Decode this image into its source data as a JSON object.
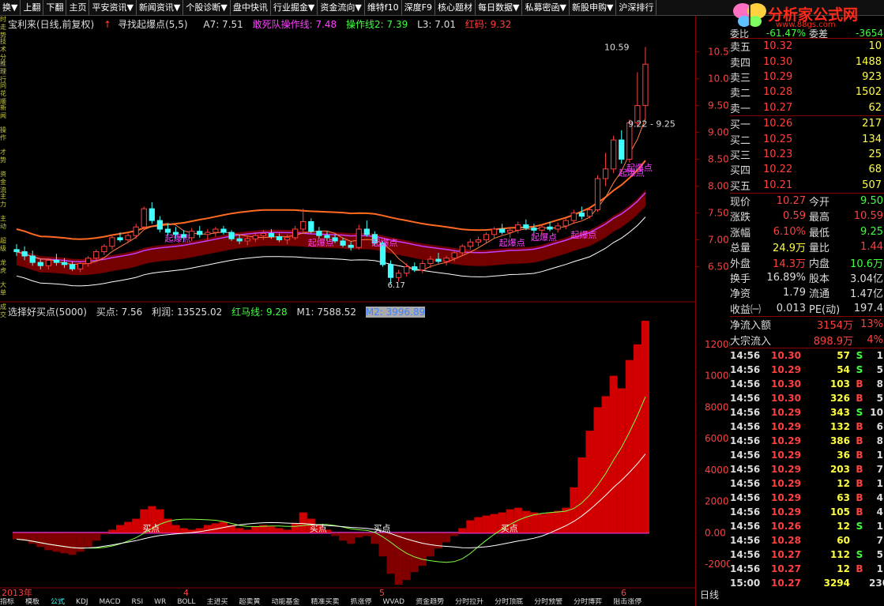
{
  "menu": [
    "换▼",
    "上翻",
    "下翻",
    "主页",
    "平安资讯▼",
    "新闻资讯▼",
    "个股诊断▼",
    "盘中快讯",
    "行业掘金▼",
    "资金流向▼",
    "维特f10",
    "深度F9",
    "核心题材",
    "每日数据▼",
    "私募密函▼",
    "新股申购▼",
    "沪深排行"
  ],
  "logo": {
    "text": "分析家公式网",
    "url": "www.88gs.com"
  },
  "left_sidebar": [
    "时走势",
    "技术分析",
    "推理行",
    "同花顺",
    "新闻",
    "操作",
    "才势",
    "资金流",
    "主力",
    "主动",
    "超级",
    "龙虎",
    "大单",
    "成交"
  ],
  "main_header": {
    "stock": "宝利来(日线,前复权)",
    "ind": "寻找起爆点(5,5)",
    "a7": "A7: 7.51",
    "dead": "敢死队操作线: 7.48",
    "op2": "操作线2: 7.39",
    "l3": "L3: 7.01",
    "red": "红码: 9.32"
  },
  "sub_header": {
    "name": "选择好买点(5000)",
    "buy": "买点: 7.56",
    "profit": "利润: 13525.02",
    "hongma": "红马线: 9.28",
    "m1": "M1: 7588.52",
    "m2": "M2: 3996.89"
  },
  "price_axis": [
    "10.50",
    "10.00",
    "9.50",
    "9.00",
    "8.50",
    "8.00",
    "7.50",
    "7.00",
    "6.50"
  ],
  "ind_axis": [
    "12000",
    "10000",
    "8000",
    "6000",
    "4000",
    "2000",
    "0.00",
    "-2000"
  ],
  "annotations": {
    "high": "10.59",
    "range": "9.22 - 9.25",
    "low": "6.17",
    "qi": "起爆点",
    "buy": "买点"
  },
  "x_labels": [
    "2013年",
    "4",
    "5",
    "6"
  ],
  "day_label": "日线",
  "order_book": {
    "top_cut": {
      "l": "委比",
      "v": "-61.47%",
      "l2": "委差",
      "v2": "-3654"
    },
    "sells": [
      {
        "label": "卖五",
        "price": "10.32",
        "vol": "10"
      },
      {
        "label": "卖四",
        "price": "10.30",
        "vol": "1488"
      },
      {
        "label": "卖三",
        "price": "10.29",
        "vol": "923"
      },
      {
        "label": "卖二",
        "price": "10.28",
        "vol": "1502"
      },
      {
        "label": "卖一",
        "price": "10.27",
        "vol": "62"
      }
    ],
    "buys": [
      {
        "label": "买一",
        "price": "10.26",
        "vol": "217"
      },
      {
        "label": "买二",
        "price": "10.25",
        "vol": "134"
      },
      {
        "label": "买三",
        "price": "10.23",
        "vol": "25"
      },
      {
        "label": "买四",
        "price": "10.22",
        "vol": "68"
      },
      {
        "label": "买五",
        "price": "10.21",
        "vol": "507"
      }
    ]
  },
  "stats": [
    {
      "l1": "现价",
      "v1": "10.27",
      "c1": "#ff4040",
      "l2": "今开",
      "v2": "9.50",
      "c2": "#40ff40"
    },
    {
      "l1": "涨跌",
      "v1": "0.59",
      "c1": "#ff4040",
      "l2": "最高",
      "v2": "10.59",
      "c2": "#ff4040"
    },
    {
      "l1": "涨幅",
      "v1": "6.10%",
      "c1": "#ff4040",
      "l2": "最低",
      "v2": "9.25",
      "c2": "#40ff40"
    },
    {
      "l1": "总量",
      "v1": "24.9万",
      "c1": "#ffff40",
      "l2": "量比",
      "v2": "1.44",
      "c2": "#ff4040"
    },
    {
      "l1": "外盘",
      "v1": "14.3万",
      "c1": "#ff4040",
      "l2": "内盘",
      "v2": "10.6万",
      "c2": "#40ff40"
    },
    {
      "l1": "换手",
      "v1": "16.89%",
      "c1": "#ddd",
      "l2": "股本",
      "v2": "3.04亿",
      "c2": "#ddd"
    },
    {
      "l1": "净资",
      "v1": "1.79",
      "c1": "#ddd",
      "l2": "流通",
      "v2": "1.47亿",
      "c2": "#ddd"
    },
    {
      "l1": "收益㈠",
      "v1": "0.013",
      "c1": "#ddd",
      "l2": "PE(动)",
      "v2": "197.4",
      "c2": "#ddd"
    }
  ],
  "flows": [
    {
      "label": "净流入额",
      "value": "3154万",
      "pct": "13%"
    },
    {
      "label": "大宗流入",
      "value": "898.9万",
      "pct": "4%"
    }
  ],
  "ticks": [
    {
      "t": "14:56",
      "p": "10.30",
      "pc": "#ff4040",
      "v": "57",
      "s": "S",
      "sc": "#40ff40",
      "n": "1"
    },
    {
      "t": "14:56",
      "p": "10.29",
      "pc": "#ff4040",
      "v": "54",
      "s": "S",
      "sc": "#40ff40",
      "n": "5"
    },
    {
      "t": "14:56",
      "p": "10.30",
      "pc": "#ff4040",
      "v": "103",
      "s": "B",
      "sc": "#ff4040",
      "n": "8"
    },
    {
      "t": "14:56",
      "p": "10.30",
      "pc": "#ff4040",
      "v": "326",
      "s": "B",
      "sc": "#ff4040",
      "n": "5"
    },
    {
      "t": "14:56",
      "p": "10.29",
      "pc": "#ff4040",
      "v": "343",
      "s": "S",
      "sc": "#40ff40",
      "n": "10"
    },
    {
      "t": "14:56",
      "p": "10.29",
      "pc": "#ff4040",
      "v": "132",
      "s": "B",
      "sc": "#ff4040",
      "n": "6"
    },
    {
      "t": "14:56",
      "p": "10.29",
      "pc": "#ff4040",
      "v": "386",
      "s": "B",
      "sc": "#ff4040",
      "n": "8"
    },
    {
      "t": "14:56",
      "p": "10.29",
      "pc": "#ff4040",
      "v": "36",
      "s": "B",
      "sc": "#ff4040",
      "n": "1"
    },
    {
      "t": "14:56",
      "p": "10.29",
      "pc": "#ff4040",
      "v": "203",
      "s": "B",
      "sc": "#ff4040",
      "n": "7"
    },
    {
      "t": "14:56",
      "p": "10.29",
      "pc": "#ff4040",
      "v": "12",
      "s": "B",
      "sc": "#ff4040",
      "n": "1"
    },
    {
      "t": "14:56",
      "p": "10.29",
      "pc": "#ff4040",
      "v": "63",
      "s": "B",
      "sc": "#ff4040",
      "n": "4"
    },
    {
      "t": "14:56",
      "p": "10.29",
      "pc": "#ff4040",
      "v": "105",
      "s": "B",
      "sc": "#ff4040",
      "n": "4"
    },
    {
      "t": "14:56",
      "p": "10.26",
      "pc": "#ff4040",
      "v": "12",
      "s": "S",
      "sc": "#40ff40",
      "n": "1"
    },
    {
      "t": "14:56",
      "p": "10.28",
      "pc": "#ff4040",
      "v": "60",
      "s": "",
      "sc": "#ddd",
      "n": "7"
    },
    {
      "t": "14:56",
      "p": "10.27",
      "pc": "#ff4040",
      "v": "112",
      "s": "S",
      "sc": "#40ff40",
      "n": "5"
    },
    {
      "t": "14:56",
      "p": "10.27",
      "pc": "#ff4040",
      "v": "12",
      "s": "B",
      "sc": "#ff4040",
      "n": "1"
    },
    {
      "t": "15:00",
      "p": "10.27",
      "pc": "#ff4040",
      "v": "3294",
      "s": "",
      "sc": "#ddd",
      "n": "230"
    }
  ],
  "bottom_tabs": [
    "指标",
    "模板",
    "公式",
    "KDJ",
    "MACD",
    "RSI",
    "WR",
    "BOLL",
    "主进买",
    "超卖黄",
    "动能基金",
    "精准买卖",
    "抓涨停",
    "WVAD",
    "资金趋势",
    "分时拉升",
    "分时顶底",
    "分时预警",
    "分时博弈",
    "阻击涨停"
  ],
  "colors": {
    "up": "#ff4040",
    "down": "#40ffff",
    "bg": "#000000",
    "axis": "#800000"
  },
  "chart_data": {
    "type": "candlestick",
    "price_ylim": [
      6.2,
      10.7
    ],
    "ind_ylim": [
      -3800,
      13800
    ],
    "candles": [
      [
        6.82,
        6.92,
        6.7,
        6.78
      ],
      [
        6.78,
        6.88,
        6.62,
        6.7
      ],
      [
        6.7,
        6.8,
        6.52,
        6.58
      ],
      [
        6.58,
        6.64,
        6.45,
        6.52
      ],
      [
        6.52,
        6.66,
        6.45,
        6.62
      ],
      [
        6.62,
        6.74,
        6.52,
        6.58
      ],
      [
        6.58,
        6.66,
        6.48,
        6.54
      ],
      [
        6.54,
        6.6,
        6.42,
        6.46
      ],
      [
        6.46,
        6.6,
        6.4,
        6.56
      ],
      [
        6.56,
        6.7,
        6.5,
        6.66
      ],
      [
        6.66,
        6.82,
        6.6,
        6.78
      ],
      [
        6.78,
        6.92,
        6.72,
        6.88
      ],
      [
        6.88,
        7.1,
        6.82,
        7.04
      ],
      [
        7.04,
        7.14,
        6.96,
        7.0
      ],
      [
        7.0,
        7.12,
        6.94,
        7.08
      ],
      [
        7.08,
        7.3,
        7.02,
        7.24
      ],
      [
        7.24,
        7.62,
        7.18,
        7.58
      ],
      [
        7.58,
        7.7,
        7.3,
        7.36
      ],
      [
        7.36,
        7.44,
        7.14,
        7.2
      ],
      [
        7.2,
        7.3,
        7.08,
        7.14
      ],
      [
        7.14,
        7.24,
        7.02,
        7.1
      ],
      [
        7.1,
        7.18,
        6.96,
        7.04
      ],
      [
        7.04,
        7.22,
        6.98,
        7.16
      ],
      [
        7.16,
        7.26,
        7.04,
        7.1
      ],
      [
        7.1,
        7.2,
        7.0,
        7.14
      ],
      [
        7.14,
        7.24,
        7.06,
        7.2
      ],
      [
        7.2,
        7.26,
        7.1,
        7.14
      ],
      [
        7.14,
        7.18,
        6.98,
        7.02
      ],
      [
        7.02,
        7.1,
        6.92,
        6.98
      ],
      [
        6.98,
        7.06,
        6.9,
        7.02
      ],
      [
        7.02,
        7.14,
        6.96,
        7.08
      ],
      [
        7.08,
        7.18,
        7.0,
        7.12
      ],
      [
        7.12,
        7.2,
        7.02,
        7.06
      ],
      [
        7.06,
        7.12,
        6.96,
        7.0
      ],
      [
        7.0,
        7.1,
        6.92,
        7.04
      ],
      [
        7.04,
        7.26,
        7.0,
        7.2
      ],
      [
        7.2,
        7.58,
        7.14,
        7.34
      ],
      [
        7.34,
        7.4,
        7.12,
        7.16
      ],
      [
        7.16,
        7.24,
        7.02,
        7.08
      ],
      [
        7.08,
        7.16,
        6.98,
        7.04
      ],
      [
        7.04,
        7.1,
        6.94,
        6.98
      ],
      [
        6.98,
        7.04,
        6.86,
        6.9
      ],
      [
        6.9,
        6.96,
        6.8,
        6.86
      ],
      [
        6.86,
        7.28,
        6.82,
        7.2
      ],
      [
        7.2,
        7.36,
        7.06,
        7.1
      ],
      [
        7.1,
        7.16,
        6.9,
        6.94
      ],
      [
        6.94,
        6.98,
        6.5,
        6.54
      ],
      [
        6.54,
        6.62,
        6.17,
        6.3
      ],
      [
        6.3,
        6.44,
        6.22,
        6.38
      ],
      [
        6.38,
        6.56,
        6.32,
        6.5
      ],
      [
        6.5,
        6.58,
        6.4,
        6.44
      ],
      [
        6.44,
        6.62,
        6.38,
        6.56
      ],
      [
        6.56,
        6.7,
        6.48,
        6.64
      ],
      [
        6.64,
        6.76,
        6.56,
        6.6
      ],
      [
        6.6,
        6.7,
        6.52,
        6.66
      ],
      [
        6.66,
        6.8,
        6.6,
        6.76
      ],
      [
        6.76,
        6.92,
        6.7,
        6.88
      ],
      [
        6.88,
        7.02,
        6.82,
        6.96
      ],
      [
        6.96,
        7.06,
        6.88,
        7.0
      ],
      [
        7.0,
        7.14,
        6.94,
        7.1
      ],
      [
        7.1,
        7.24,
        7.02,
        7.2
      ],
      [
        7.2,
        7.3,
        7.1,
        7.14
      ],
      [
        7.14,
        7.22,
        7.04,
        7.18
      ],
      [
        7.18,
        7.34,
        7.12,
        7.28
      ],
      [
        7.28,
        7.38,
        7.18,
        7.22
      ],
      [
        7.22,
        7.3,
        7.12,
        7.18
      ],
      [
        7.18,
        7.28,
        7.1,
        7.24
      ],
      [
        7.24,
        7.34,
        7.16,
        7.2
      ],
      [
        7.2,
        7.32,
        7.14,
        7.26
      ],
      [
        7.26,
        7.4,
        7.2,
        7.36
      ],
      [
        7.36,
        7.56,
        7.3,
        7.5
      ],
      [
        7.5,
        7.62,
        7.38,
        7.44
      ],
      [
        7.44,
        7.6,
        7.4,
        7.56
      ],
      [
        7.56,
        8.2,
        7.52,
        8.14
      ],
      [
        8.14,
        8.62,
        8.0,
        8.32
      ],
      [
        8.32,
        8.94,
        8.24,
        8.86
      ],
      [
        8.86,
        9.04,
        8.42,
        8.5
      ],
      [
        8.5,
        9.24,
        8.44,
        9.18
      ],
      [
        9.18,
        10.12,
        9.1,
        9.5
      ],
      [
        9.5,
        10.59,
        9.25,
        10.27
      ]
    ],
    "ind_bars": [
      -400,
      -500,
      -700,
      -900,
      -1100,
      -1200,
      -1300,
      -1400,
      -1200,
      -900,
      -500,
      -100,
      200,
      500,
      700,
      900,
      1500,
      1700,
      1500,
      900,
      500,
      300,
      200,
      300,
      500,
      600,
      700,
      500,
      300,
      200,
      400,
      500,
      400,
      300,
      200,
      600,
      1300,
      900,
      500,
      200,
      -200,
      -500,
      -700,
      -300,
      -200,
      -700,
      -1500,
      -2600,
      -3300,
      -3000,
      -2500,
      -2100,
      -1500,
      -1000,
      -600,
      -200,
      300,
      800,
      1000,
      1100,
      1200,
      1300,
      1500,
      1600,
      1400,
      1300,
      1200,
      1300,
      1400,
      1600,
      2900,
      4800,
      6500,
      8000,
      8700,
      10000,
      9200,
      11000,
      12000,
      13500
    ],
    "labels_qi": [
      [
        20,
        7.03
      ],
      [
        38,
        6.95
      ],
      [
        46,
        6.95
      ],
      [
        62,
        6.95
      ],
      [
        66,
        7.05
      ],
      [
        71,
        7.1
      ],
      [
        77,
        8.25
      ],
      [
        78,
        8.35
      ]
    ],
    "buy_points": [
      [
        17,
        0
      ],
      [
        38,
        0
      ],
      [
        46,
        0
      ],
      [
        62,
        0
      ]
    ]
  }
}
